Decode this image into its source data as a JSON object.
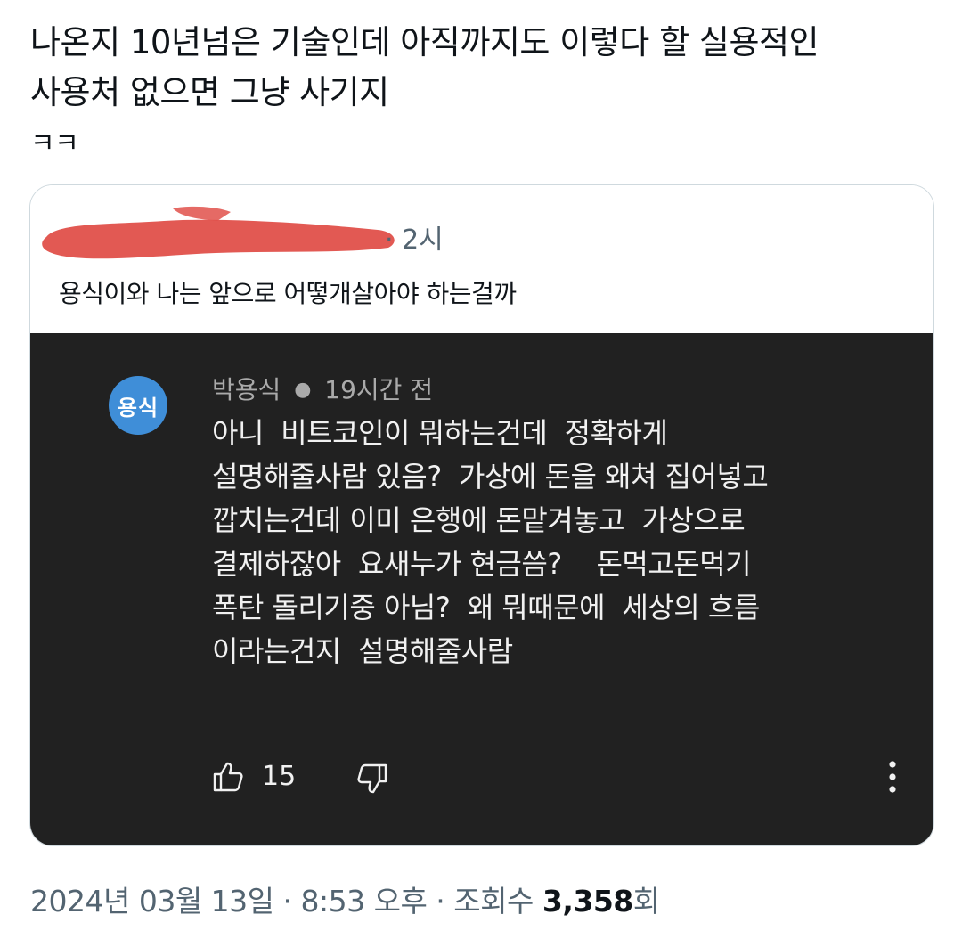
{
  "tweet": {
    "lines": [
      "나온지 10년넘은 기술인데 아직까지도 이렇다 할 실용적인",
      "사용처 없으면 그냥 사기지",
      "ㅋㅋ"
    ]
  },
  "quote": {
    "time": "· 2시",
    "text": "용식이와 나는 앞으로 어떻개살아야 하는걸까",
    "redaction_color": "#e0504a",
    "comment": {
      "avatar_text": "용식",
      "avatar_color": "#3f8ed8",
      "author": "박용식",
      "time": "19시간 전",
      "body_lines": [
        "아니  비트코인이 뭐하는건데  정확하게",
        "설명해줄사람 있음?  가상에 돈을 왜쳐 집어넣고",
        "깝치는건데 이미 은행에 돈맡겨놓고  가상으로",
        "결제하잖아  요새누가 현금씀?    돈먹고돈먹기",
        "폭탄 돌리기중 아님?  왜 뭐때문에  세상의 흐름",
        "이라는건지  설명해줄사람"
      ],
      "likes": "15",
      "icons": [
        "thumbs-up-icon",
        "thumbs-down-icon",
        "more-vertical-icon"
      ]
    }
  },
  "footer": {
    "date_time": "2024년 03월 13일 · 8:53 오후 · 조회수 ",
    "views": "3,358",
    "views_unit": "회"
  }
}
